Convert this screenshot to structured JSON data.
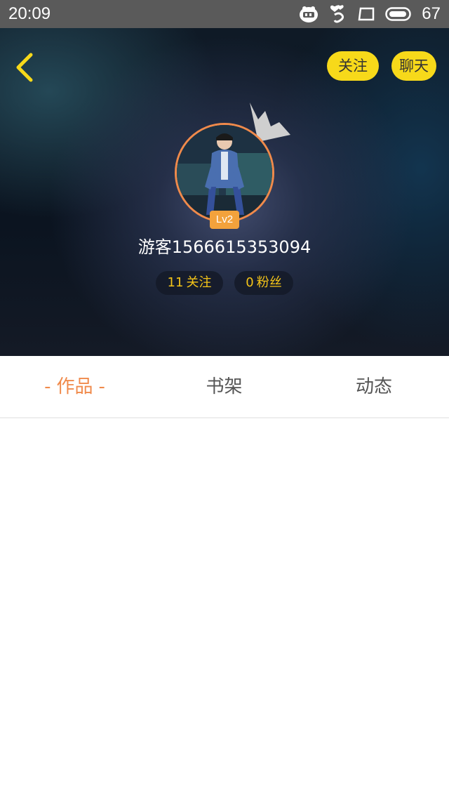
{
  "status_bar": {
    "time": "20:09",
    "battery": "67",
    "icons": [
      "notification-app-icon",
      "heart-notification-icon",
      "square-icon",
      "battery-icon"
    ]
  },
  "header": {
    "back_icon": "chevron-left-icon",
    "follow_label": "关注",
    "chat_label": "聊天"
  },
  "profile": {
    "level": "Lv2",
    "username": "游客1566615353094",
    "following_count": "11",
    "following_label": "关注",
    "fans_count": "0",
    "fans_label": "粉丝"
  },
  "tabs": {
    "works": "作品",
    "works_dash": "-",
    "shelf": "书架",
    "activity": "动态"
  },
  "colors": {
    "accent_yellow": "#f7d91a",
    "accent_orange": "#f08a4b",
    "stat_text": "#f5c518"
  }
}
